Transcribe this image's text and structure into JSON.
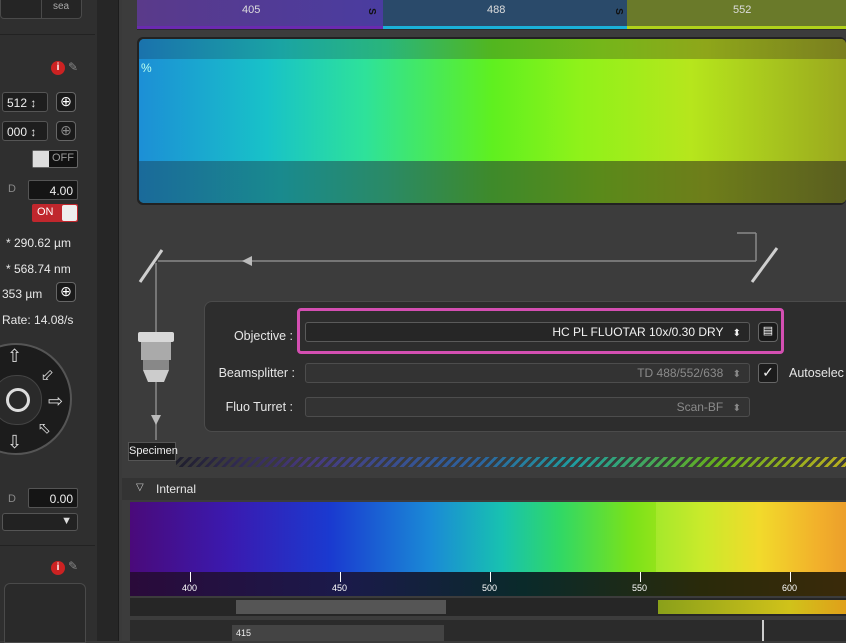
{
  "left_panel": {
    "top_button": "sea",
    "info_badge": "i",
    "select_1": "512 ↕",
    "select_2": "000 ↕",
    "toggle_off": "OFF",
    "value_1": "4.00",
    "toggle_on": "ON",
    "text_1": "* 290.62 µm",
    "text_2": "* 568.74 nm",
    "text_3": "353 µm",
    "rate": "Rate: 14.08/s",
    "value_2": "0.00",
    "plus": "+"
  },
  "spectrum_top": {
    "ticks": [
      "405",
      "488",
      "552"
    ],
    "percent_label": "%",
    "segment_markers": [
      "S",
      "S"
    ]
  },
  "beam_path": {
    "objective_label": "Objective :",
    "objective_value": "HC PL FLUOTAR   10x/0.30 DRY",
    "beamsplitter_label": "Beamsplitter :",
    "beamsplitter_value": "TD 488/552/638",
    "autoselect_label": "Autoselec",
    "fluo_turret_label": "Fluo Turret :",
    "fluo_turret_value": "Scan-BF",
    "specimen_label": "Specimen"
  },
  "internal": {
    "section_label": "Internal",
    "axis_ticks": [
      "400",
      "450",
      "500",
      "550",
      "600"
    ],
    "bottom_tick": "415"
  },
  "colors": {
    "highlight": "#d44fb2",
    "toggle_on": "#c0272d"
  }
}
